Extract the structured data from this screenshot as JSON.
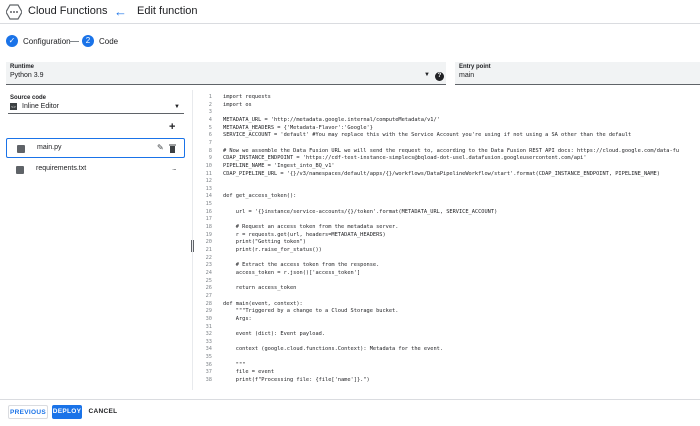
{
  "header": {
    "app_title": "Cloud Functions",
    "page_title": "Edit function",
    "logo_icon": "cloud-functions-logo",
    "back_icon": "arrow-back-icon"
  },
  "stepper": {
    "steps": [
      {
        "label": "Configuration",
        "state": "done",
        "mark": "✓"
      },
      {
        "label": "Code",
        "state": "active",
        "mark": "2"
      }
    ]
  },
  "runtime": {
    "label": "Runtime",
    "value": "Python 3.9"
  },
  "entry_point": {
    "label": "Entry point",
    "value": "main"
  },
  "source": {
    "label": "Source code",
    "value": "Inline Editor"
  },
  "files": [
    {
      "name": "main.py",
      "selected": true
    },
    {
      "name": "requirements.txt",
      "selected": false
    }
  ],
  "code": [
    {
      "n": "1",
      "t": "import requests"
    },
    {
      "n": "2",
      "t": "import os"
    },
    {
      "n": "3",
      "t": ""
    },
    {
      "n": "4",
      "t": "METADATA_URL = 'http://metadata.google.internal/computeMetadata/v1/'"
    },
    {
      "n": "5",
      "t": "METADATA_HEADERS = {'Metadata-Flavor':'Google'}"
    },
    {
      "n": "6",
      "t": "SERVICE_ACCOUNT = 'default' #You may replace this with the Service Account you're using if not using a SA other than the default"
    },
    {
      "n": "7",
      "t": ""
    },
    {
      "n": "8",
      "t": "# Now we assemble the Data Fusion URL we will send the request to, according to the Data Fusion REST API docs: https://cloud.google.com/data-fu"
    },
    {
      "n": "9",
      "t": "CDAP_INSTANCE_ENDPOINT = 'https://cdf-test-instance-simplecs@bqload-dot-usel.datafusion.googleusercontent.com/api'"
    },
    {
      "n": "10",
      "t": "PIPELINE_NAME = 'Ingest_into_BQ_v1'"
    },
    {
      "n": "11",
      "t": "CDAP_PIPELINE_URL = '{}/v3/namespaces/default/apps/{}/workflows/DataPipelineWorkflow/start'.format(CDAP_INSTANCE_ENDPOINT, PIPELINE_NAME)"
    },
    {
      "n": "12",
      "t": ""
    },
    {
      "n": "13",
      "t": ""
    },
    {
      "n": "14",
      "t": "def get_access_token():"
    },
    {
      "n": "15",
      "t": ""
    },
    {
      "n": "16",
      "t": "    url = '{}instance/service-accounts/{}/token'.format(METADATA_URL, SERVICE_ACCOUNT)"
    },
    {
      "n": "17",
      "t": ""
    },
    {
      "n": "18",
      "t": "    # Request an access token from the metadata server."
    },
    {
      "n": "19",
      "t": "    r = requests.get(url, headers=METADATA_HEADERS)"
    },
    {
      "n": "20",
      "t": "    print(\"Getting token\")"
    },
    {
      "n": "21",
      "t": "    print(r.raise_for_status())"
    },
    {
      "n": "22",
      "t": ""
    },
    {
      "n": "23",
      "t": "    # Extract the access token from the response."
    },
    {
      "n": "24",
      "t": "    access_token = r.json()['access_token']"
    },
    {
      "n": "25",
      "t": ""
    },
    {
      "n": "26",
      "t": "    return access_token"
    },
    {
      "n": "27",
      "t": ""
    },
    {
      "n": "28",
      "t": "def main(event, context):"
    },
    {
      "n": "29",
      "t": "    \"\"\"Triggered by a change to a Cloud Storage bucket."
    },
    {
      "n": "30",
      "t": "    Args:"
    },
    {
      "n": "31",
      "t": ""
    },
    {
      "n": "32",
      "t": "    event (dict): Event payload."
    },
    {
      "n": "33",
      "t": ""
    },
    {
      "n": "34",
      "t": "    context (google.cloud.functions.Context): Metadata for the event."
    },
    {
      "n": "35",
      "t": ""
    },
    {
      "n": "36",
      "t": "    \"\"\""
    },
    {
      "n": "37",
      "t": "    file = event"
    },
    {
      "n": "38",
      "t": "    print(f\"Processing file: {file['name']}.\")"
    }
  ],
  "footer": {
    "previous": "PREVIOUS",
    "deploy": "DEPLOY",
    "cancel": "CANCEL"
  },
  "colors": {
    "accent": "#1a73e8"
  }
}
